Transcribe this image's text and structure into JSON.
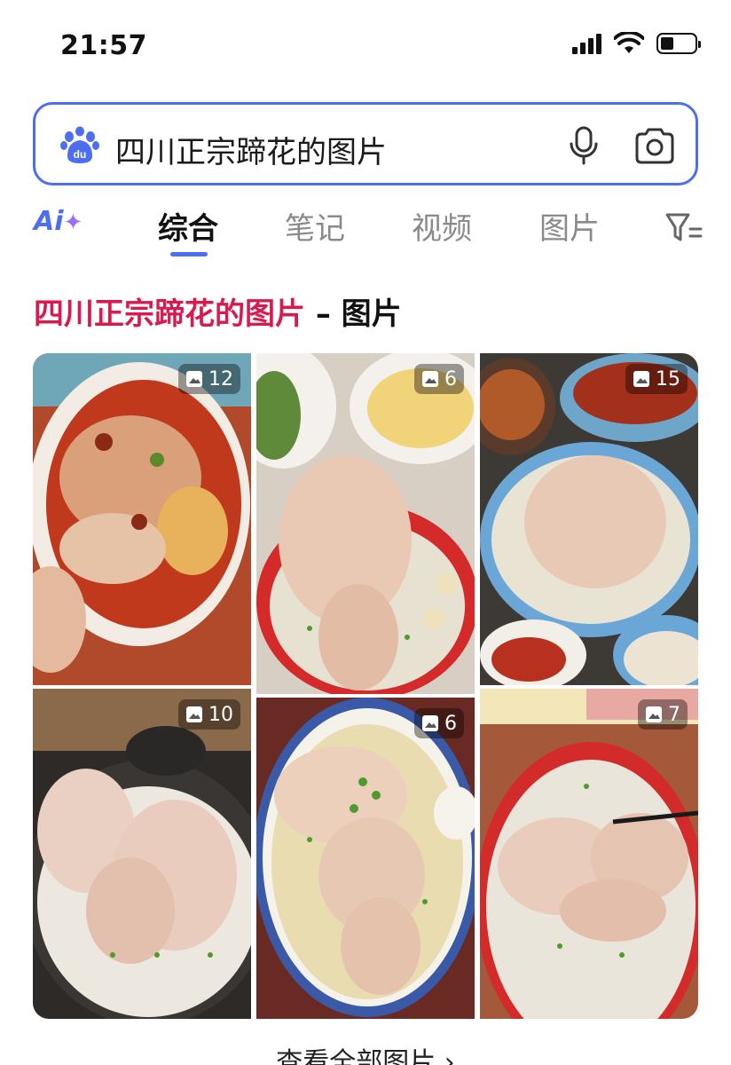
{
  "status_bar": {
    "time": "21:57",
    "battery_level": 0.4
  },
  "search": {
    "query": "四川正宗蹄花的图片",
    "logo_text": "du"
  },
  "tabs": {
    "ai_label": "Ai",
    "items": [
      {
        "label": "综合",
        "active": true
      },
      {
        "label": "笔记",
        "active": false
      },
      {
        "label": "视频",
        "active": false
      },
      {
        "label": "图片",
        "active": false
      }
    ]
  },
  "section": {
    "query_text": "四川正宗蹄花的图片",
    "suffix": " – 图片"
  },
  "images": [
    {
      "count": "12"
    },
    {
      "count": "6"
    },
    {
      "count": "15"
    },
    {
      "count": "10"
    },
    {
      "count": "6"
    },
    {
      "count": "7"
    }
  ],
  "see_all": {
    "label": "查看全部图片 ›"
  },
  "colors": {
    "accent": "#4e6ef2",
    "query_red": "#d91a4e"
  }
}
